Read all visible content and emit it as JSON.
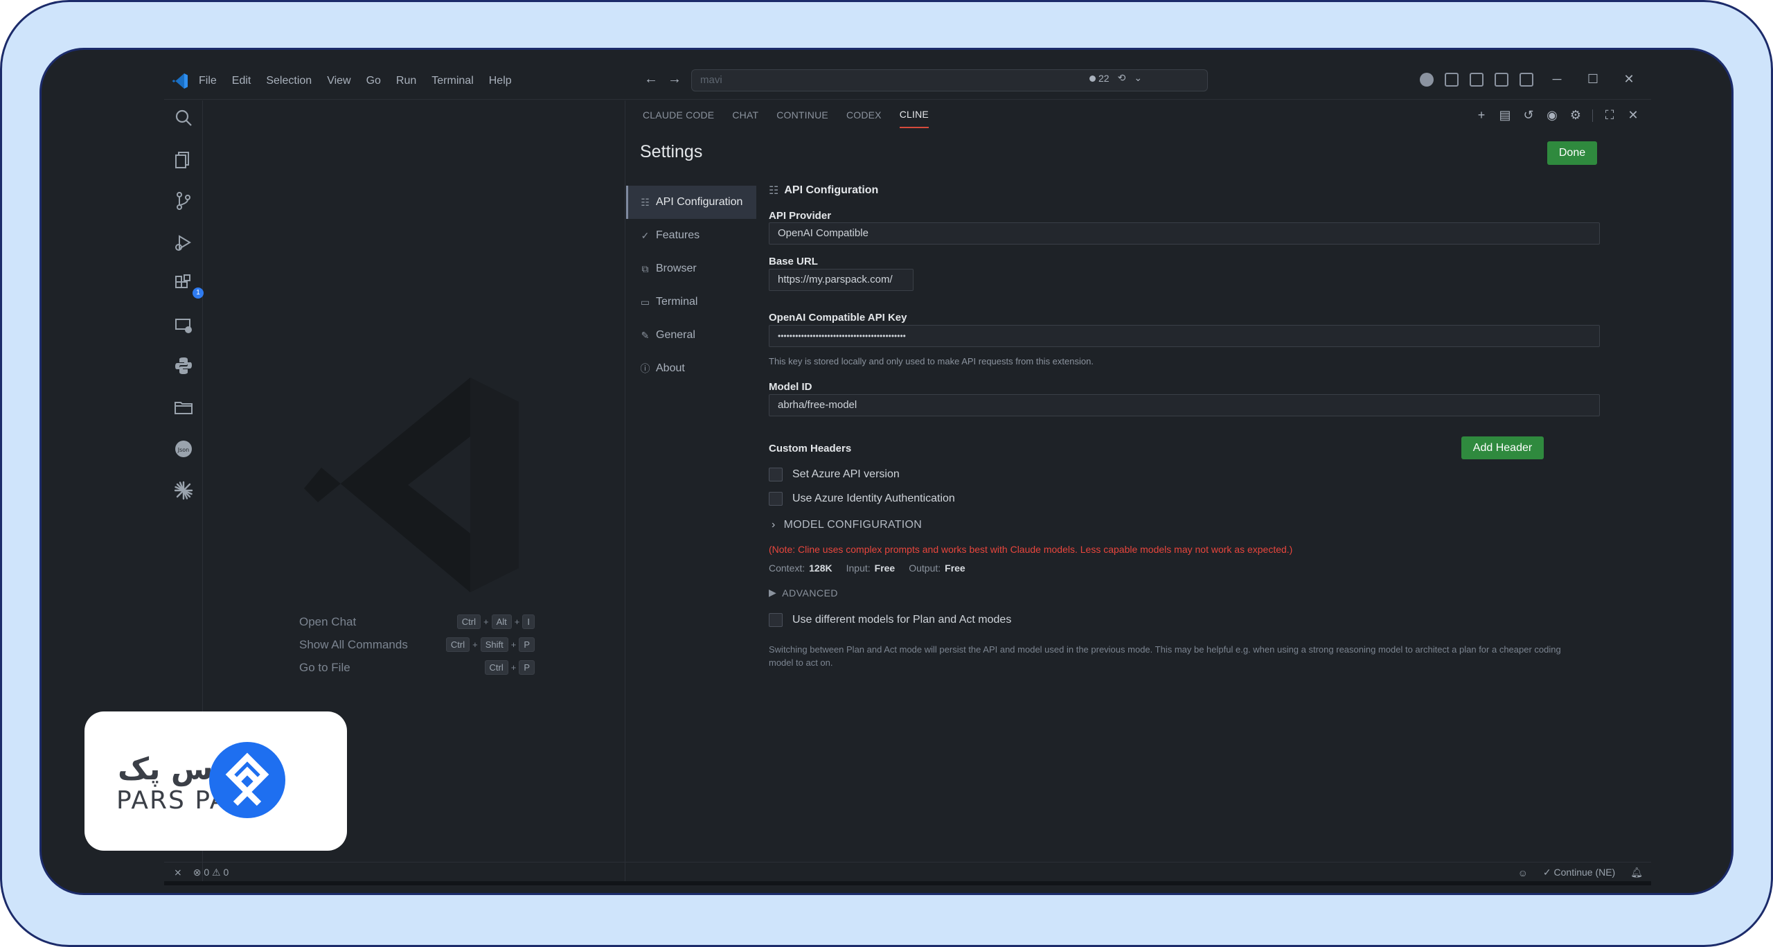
{
  "menu": [
    "File",
    "Edit",
    "Selection",
    "View",
    "Go",
    "Run",
    "Terminal",
    "Help"
  ],
  "command_center": {
    "placeholder": "mavi",
    "count": "22"
  },
  "activity_badge": "1",
  "welcome": {
    "shortcuts": [
      {
        "label": "Open Chat",
        "keys": [
          "Ctrl",
          "+",
          "Alt",
          "+",
          "I"
        ]
      },
      {
        "label": "Show All Commands",
        "keys": [
          "Ctrl",
          "+",
          "Shift",
          "+",
          "P"
        ]
      },
      {
        "label": "Go to File",
        "keys": [
          "Ctrl",
          "+",
          "P"
        ]
      }
    ]
  },
  "panel": {
    "tabs": [
      "CLAUDE CODE",
      "CHAT",
      "CONTINUE",
      "CODEX",
      "CLINE"
    ],
    "active_tab": "CLINE",
    "title": "Settings",
    "done_label": "Done",
    "nav": [
      "API Configuration",
      "Features",
      "Browser",
      "Terminal",
      "General",
      "About"
    ],
    "section_title": "API Configuration",
    "api_provider_label": "API Provider",
    "api_provider_value": "OpenAI Compatible",
    "base_url_label": "Base URL",
    "base_url_value": "https://my.parspack.com/",
    "api_key_label": "OpenAI Compatible API Key",
    "api_key_value": "••••••••••••••••••••••••••••••••••••••••••••",
    "api_key_help": "This key is stored locally and only used to make API requests from this extension.",
    "model_id_label": "Model ID",
    "model_id_value": "abrha/free-model",
    "custom_headers_label": "Custom Headers",
    "add_header_label": "Add Header",
    "azure_api_version": "Set Azure API version",
    "azure_identity": "Use Azure Identity Authentication",
    "model_configuration": "MODEL CONFIGURATION",
    "note": "(Note: Cline uses complex prompts and works best with Claude models. Less capable models may not work as expected.)",
    "context_label": "Context:",
    "context_value": "128K",
    "input_label": "Input:",
    "input_value": "Free",
    "output_label": "Output:",
    "output_value": "Free",
    "advanced": "ADVANCED",
    "plan_act_label": "Use different models for Plan and Act modes",
    "plan_act_help": "Switching between Plan and Act mode will persist the API and model used in the previous mode. This may be helpful e.g. when using a strong reasoning model to architect a plan for a cheaper coding model to act on."
  },
  "statusbar": {
    "errors": "0",
    "warnings": "0",
    "continue": "Continue (NE)"
  },
  "brand": {
    "name_fa": "پارس پک",
    "name_en": "PARS PACK",
    "accent": "#1e6ff0"
  }
}
